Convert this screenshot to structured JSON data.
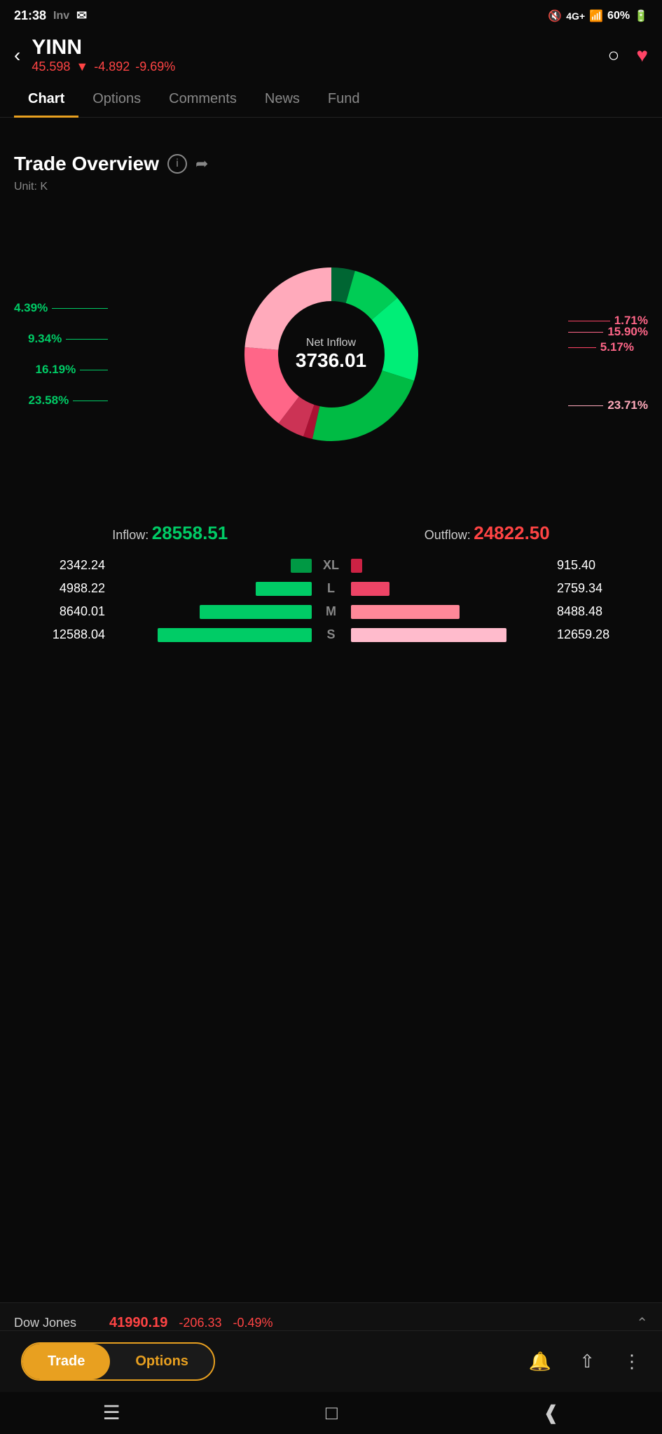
{
  "status_bar": {
    "time": "21:38",
    "app": "Inv",
    "battery": "60%"
  },
  "header": {
    "symbol": "YINN",
    "price": "45.598",
    "change": "-4.892",
    "change_pct": "-9.69%",
    "back_label": "←",
    "search_label": "🔍",
    "favorite_label": "♥"
  },
  "tabs": [
    {
      "id": "chart",
      "label": "Chart",
      "active": true
    },
    {
      "id": "options",
      "label": "Options",
      "active": false
    },
    {
      "id": "comments",
      "label": "Comments",
      "active": false
    },
    {
      "id": "news",
      "label": "News",
      "active": false
    },
    {
      "id": "fund",
      "label": "Fund",
      "active": false
    }
  ],
  "trade_overview": {
    "title": "Trade Overview",
    "unit": "Unit: K",
    "net_inflow_label": "Net Inflow",
    "net_inflow_value": "3736.01",
    "donut_segments": [
      {
        "pct": 4.39,
        "color": "#00cc66",
        "label": "4.39%",
        "side": "left"
      },
      {
        "pct": 9.34,
        "color": "#22dd66",
        "label": "9.34%",
        "side": "left"
      },
      {
        "pct": 16.19,
        "color": "#44ee88",
        "label": "16.19%",
        "side": "left"
      },
      {
        "pct": 23.58,
        "color": "#00bb55",
        "label": "23.58%",
        "side": "left"
      },
      {
        "pct": 1.71,
        "color": "#cc2244",
        "label": "1.71%",
        "side": "right"
      },
      {
        "pct": 5.17,
        "color": "#dd3355",
        "label": "5.17%",
        "side": "right"
      },
      {
        "pct": 15.9,
        "color": "#ff6688",
        "label": "15.90%",
        "side": "right"
      },
      {
        "pct": 23.71,
        "color": "#ffaabb",
        "label": "23.71%",
        "side": "right"
      }
    ]
  },
  "flow_summary": {
    "inflow_label": "Inflow:",
    "inflow_value": "28558.51",
    "outflow_label": "Outflow:",
    "outflow_value": "24822.50"
  },
  "bar_rows": [
    {
      "size_label": "XL",
      "left_value": "2342.24",
      "left_bar_width": 30,
      "right_value": "915.40",
      "right_bar_width": 16
    },
    {
      "size_label": "L",
      "left_value": "4988.22",
      "left_bar_width": 80,
      "right_value": "2759.34",
      "right_bar_width": 55
    },
    {
      "size_label": "M",
      "left_value": "8640.01",
      "left_bar_width": 160,
      "right_value": "8488.48",
      "right_bar_width": 155
    },
    {
      "size_label": "S",
      "left_value": "12588.04",
      "left_bar_width": 220,
      "right_value": "12659.28",
      "right_bar_width": 222
    }
  ],
  "bottom_ticker": {
    "name": "Dow Jones",
    "price": "41990.19",
    "change": "-206.33",
    "change_pct": "-0.49%"
  },
  "bottom_nav": {
    "trade_label": "Trade",
    "options_label": "Options"
  }
}
